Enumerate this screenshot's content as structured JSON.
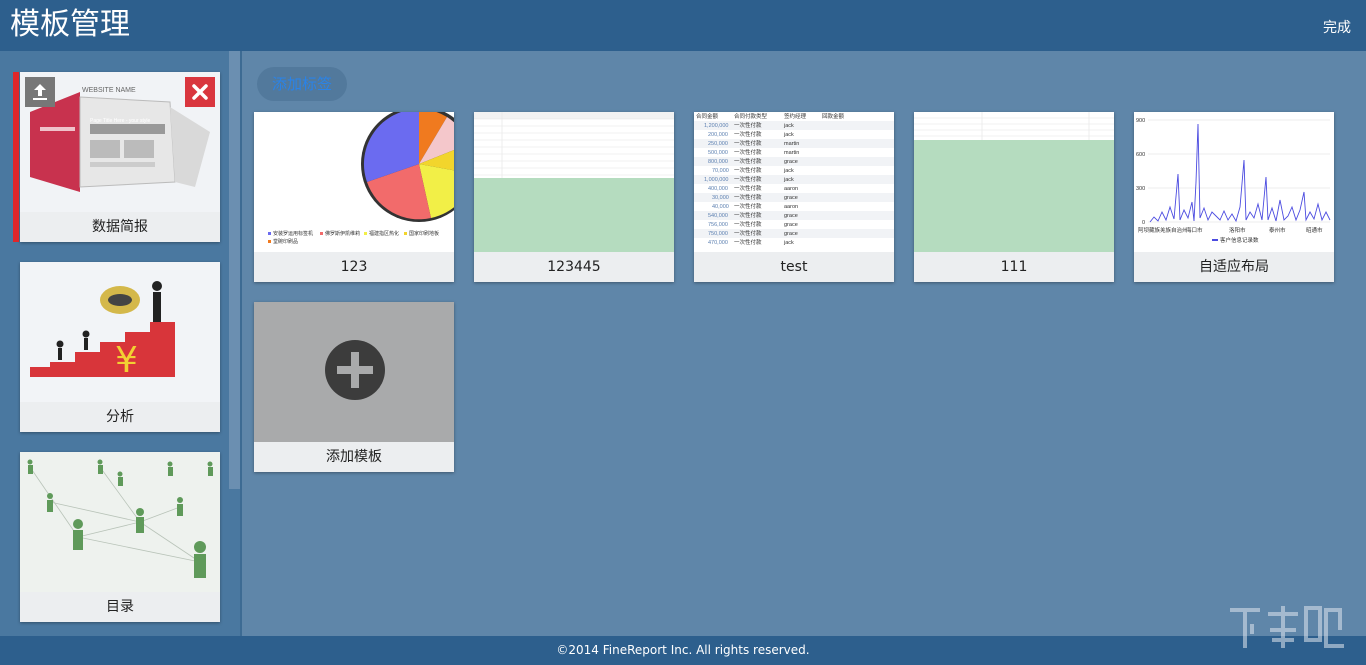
{
  "header": {
    "title": "模板管理",
    "done_label": "完成"
  },
  "sidebar": {
    "items": [
      {
        "label": "数据简报",
        "active": true
      },
      {
        "label": "分析"
      },
      {
        "label": "目录"
      }
    ]
  },
  "main": {
    "add_tag_label": "添加标签",
    "templates": [
      {
        "label": "123",
        "thumb": "pie-chart"
      },
      {
        "label": "123445",
        "thumb": "report-table"
      },
      {
        "label": "test",
        "thumb": "data-table"
      },
      {
        "label": "111",
        "thumb": "report-table"
      },
      {
        "label": "自适应布局",
        "thumb": "line-chart"
      }
    ],
    "add_template_label": "添加模板"
  },
  "footer": {
    "copyright": "©2014 FineReport Inc. All rights reserved."
  },
  "colors": {
    "header": "#2d5f8d",
    "background": "#5f86a9",
    "active": "#e0262a",
    "add_tag_text": "#2a83e8"
  }
}
